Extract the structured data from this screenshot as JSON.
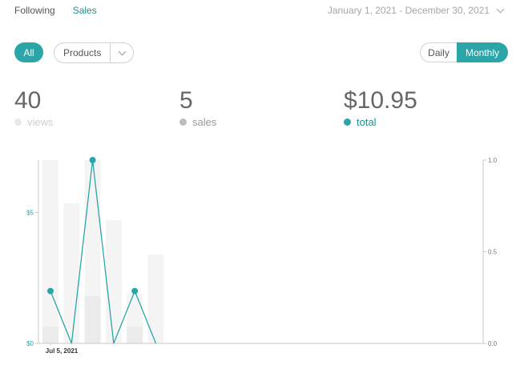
{
  "tabs": {
    "following": "Following",
    "sales": "Sales"
  },
  "date_range": "January 1, 2021 - December 30, 2021",
  "filters": {
    "all": "All",
    "products": "Products"
  },
  "period": {
    "daily": "Daily",
    "monthly": "Monthly",
    "selected": "Monthly"
  },
  "stats": [
    {
      "value": "40",
      "label": "views",
      "color": "#e8e8e8",
      "text_color": "#cfcfcf"
    },
    {
      "value": "5",
      "label": "sales",
      "color": "#bdbdbd",
      "text_color": "#999999"
    },
    {
      "value": "$10.95",
      "label": "total",
      "color": "#2ba5a8",
      "text_color": "#1f8d8d"
    }
  ],
  "chart_data": {
    "type": "bar",
    "x_tick_label": "Jul 5, 2021",
    "left_axis": {
      "ticks": [
        "$0",
        "$5"
      ],
      "tick_values": [
        0,
        5
      ],
      "ylim": [
        0,
        7
      ],
      "color": "#2ba5a8"
    },
    "right_axis": {
      "ticks": [
        "0.0",
        "0.5",
        "1.0"
      ],
      "tick_values": [
        0,
        0.5,
        1
      ],
      "ylim": [
        0,
        1
      ]
    },
    "series": [
      {
        "name": "views",
        "type": "bar",
        "values": [
          7,
          5.35,
          7,
          4.7,
          1.9,
          3.4
        ]
      },
      {
        "name": "sales",
        "type": "bar",
        "values": [
          0.65,
          0,
          1.8,
          0,
          0.65,
          0
        ]
      },
      {
        "name": "total",
        "type": "line",
        "values": [
          2,
          0,
          7,
          0,
          2,
          0
        ]
      }
    ]
  }
}
